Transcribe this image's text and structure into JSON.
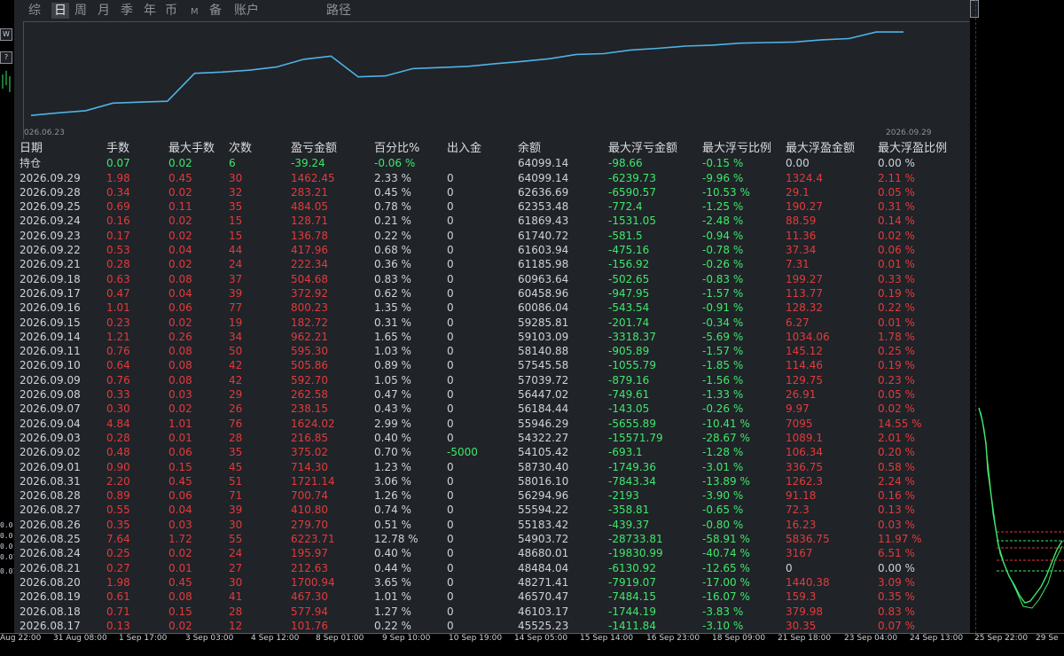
{
  "tabs": [
    "综",
    "日",
    "周",
    "月",
    "季",
    "年",
    "币",
    "M",
    "备",
    "账户",
    "路径"
  ],
  "active_tab": "日",
  "chart": {
    "start_date": "026.06.23",
    "end_date": "2026.09.29",
    "line_color": "#4fb3e6"
  },
  "headers": [
    "日期",
    "手数",
    "最大手数",
    "次数",
    "盈亏金额",
    "百分比%",
    "出入金",
    "余额",
    "最大浮亏金额",
    "最大浮亏比例",
    "最大浮盈金额",
    "最大浮盈比例"
  ],
  "holding": [
    "持仓",
    "0.07",
    "0.02",
    "6",
    "-39.24",
    "-0.06 %",
    "",
    "64099.14",
    "-98.66",
    "-0.15 %",
    "0.00",
    "0.00 %"
  ],
  "rows": [
    [
      "2026.09.29",
      "1.98",
      "0.45",
      "30",
      "1462.45",
      "2.33 %",
      "0",
      "64099.14",
      "-6239.73",
      "-9.96 %",
      "1324.4",
      "2.11 %"
    ],
    [
      "2026.09.28",
      "0.34",
      "0.02",
      "32",
      "283.21",
      "0.45 %",
      "0",
      "62636.69",
      "-6590.57",
      "-10.53 %",
      "29.1",
      "0.05 %"
    ],
    [
      "2026.09.25",
      "0.69",
      "0.11",
      "35",
      "484.05",
      "0.78 %",
      "0",
      "62353.48",
      "-772.4",
      "-1.25 %",
      "190.27",
      "0.31 %"
    ],
    [
      "2026.09.24",
      "0.16",
      "0.02",
      "15",
      "128.71",
      "0.21 %",
      "0",
      "61869.43",
      "-1531.05",
      "-2.48 %",
      "88.59",
      "0.14 %"
    ],
    [
      "2026.09.23",
      "0.17",
      "0.02",
      "15",
      "136.78",
      "0.22 %",
      "0",
      "61740.72",
      "-581.5",
      "-0.94 %",
      "11.36",
      "0.02 %"
    ],
    [
      "2026.09.22",
      "0.53",
      "0.04",
      "44",
      "417.96",
      "0.68 %",
      "0",
      "61603.94",
      "-475.16",
      "-0.78 %",
      "37.34",
      "0.06 %"
    ],
    [
      "2026.09.21",
      "0.28",
      "0.02",
      "24",
      "222.34",
      "0.36 %",
      "0",
      "61185.98",
      "-156.92",
      "-0.26 %",
      "7.31",
      "0.01 %"
    ],
    [
      "2026.09.18",
      "0.63",
      "0.08",
      "37",
      "504.68",
      "0.83 %",
      "0",
      "60963.64",
      "-502.65",
      "-0.83 %",
      "199.27",
      "0.33 %"
    ],
    [
      "2026.09.17",
      "0.47",
      "0.04",
      "39",
      "372.92",
      "0.62 %",
      "0",
      "60458.96",
      "-947.95",
      "-1.57 %",
      "113.77",
      "0.19 %"
    ],
    [
      "2026.09.16",
      "1.01",
      "0.06",
      "77",
      "800.23",
      "1.35 %",
      "0",
      "60086.04",
      "-543.54",
      "-0.91 %",
      "128.32",
      "0.22 %"
    ],
    [
      "2026.09.15",
      "0.23",
      "0.02",
      "19",
      "182.72",
      "0.31 %",
      "0",
      "59285.81",
      "-201.74",
      "-0.34 %",
      "6.27",
      "0.01 %"
    ],
    [
      "2026.09.14",
      "1.21",
      "0.26",
      "34",
      "962.21",
      "1.65 %",
      "0",
      "59103.09",
      "-3318.37",
      "-5.69 %",
      "1034.06",
      "1.78 %"
    ],
    [
      "2026.09.11",
      "0.76",
      "0.08",
      "50",
      "595.30",
      "1.03 %",
      "0",
      "58140.88",
      "-905.89",
      "-1.57 %",
      "145.12",
      "0.25 %"
    ],
    [
      "2026.09.10",
      "0.64",
      "0.08",
      "42",
      "505.86",
      "0.89 %",
      "0",
      "57545.58",
      "-1055.79",
      "-1.85 %",
      "114.46",
      "0.19 %"
    ],
    [
      "2026.09.09",
      "0.76",
      "0.08",
      "42",
      "592.70",
      "1.05 %",
      "0",
      "57039.72",
      "-879.16",
      "-1.56 %",
      "129.75",
      "0.23 %"
    ],
    [
      "2026.09.08",
      "0.33",
      "0.03",
      "29",
      "262.58",
      "0.47 %",
      "0",
      "56447.02",
      "-749.61",
      "-1.33 %",
      "26.91",
      "0.05 %"
    ],
    [
      "2026.09.07",
      "0.30",
      "0.02",
      "26",
      "238.15",
      "0.43 %",
      "0",
      "56184.44",
      "-143.05",
      "-0.26 %",
      "9.97",
      "0.02 %"
    ],
    [
      "2026.09.04",
      "4.84",
      "1.01",
      "76",
      "1624.02",
      "2.99 %",
      "0",
      "55946.29",
      "-5655.89",
      "-10.41 %",
      "7095",
      "14.55 %"
    ],
    [
      "2026.09.03",
      "0.28",
      "0.01",
      "28",
      "216.85",
      "0.40 %",
      "0",
      "54322.27",
      "-15571.79",
      "-28.67 %",
      "1089.1",
      "2.01 %"
    ],
    [
      "2026.09.02",
      "0.48",
      "0.06",
      "35",
      "375.02",
      "0.70 %",
      "-5000",
      "54105.42",
      "-693.1",
      "-1.28 %",
      "106.34",
      "0.20 %"
    ],
    [
      "2026.09.01",
      "0.90",
      "0.15",
      "45",
      "714.30",
      "1.23 %",
      "0",
      "58730.40",
      "-1749.36",
      "-3.01 %",
      "336.75",
      "0.58 %"
    ],
    [
      "2026.08.31",
      "2.20",
      "0.45",
      "51",
      "1721.14",
      "3.06 %",
      "0",
      "58016.10",
      "-7843.34",
      "-13.89 %",
      "1262.3",
      "2.24 %"
    ],
    [
      "2026.08.28",
      "0.89",
      "0.06",
      "71",
      "700.74",
      "1.26 %",
      "0",
      "56294.96",
      "-2193",
      "-3.90 %",
      "91.18",
      "0.16 %"
    ],
    [
      "2026.08.27",
      "0.55",
      "0.04",
      "39",
      "410.80",
      "0.74 %",
      "0",
      "55594.22",
      "-358.81",
      "-0.65 %",
      "72.3",
      "0.13 %"
    ],
    [
      "2026.08.26",
      "0.35",
      "0.03",
      "30",
      "279.70",
      "0.51 %",
      "0",
      "55183.42",
      "-439.37",
      "-0.80 %",
      "16.23",
      "0.03 %"
    ],
    [
      "2026.08.25",
      "7.64",
      "1.72",
      "55",
      "6223.71",
      "12.78 %",
      "0",
      "54903.72",
      "-28733.81",
      "-58.91 %",
      "5836.75",
      "11.97 %"
    ],
    [
      "2026.08.24",
      "0.25",
      "0.02",
      "24",
      "195.97",
      "0.40 %",
      "0",
      "48680.01",
      "-19830.99",
      "-40.74 %",
      "3167",
      "6.51 %"
    ],
    [
      "2026.08.21",
      "0.27",
      "0.01",
      "27",
      "212.63",
      "0.44 %",
      "0",
      "48484.04",
      "-6130.92",
      "-12.65 %",
      "0",
      "0.00 %"
    ],
    [
      "2026.08.20",
      "1.98",
      "0.45",
      "30",
      "1700.94",
      "3.65 %",
      "0",
      "48271.41",
      "-7919.07",
      "-17.00 %",
      "1440.38",
      "3.09 %"
    ],
    [
      "2026.08.19",
      "0.61",
      "0.08",
      "41",
      "467.30",
      "1.01 %",
      "0",
      "46570.47",
      "-7484.15",
      "-16.07 %",
      "159.3",
      "0.35 %"
    ],
    [
      "2026.08.18",
      "0.71",
      "0.15",
      "28",
      "577.94",
      "1.27 %",
      "0",
      "46103.17",
      "-1744.19",
      "-3.83 %",
      "379.98",
      "0.83 %"
    ],
    [
      "2026.08.17",
      "0.13",
      "0.02",
      "12",
      "101.76",
      "0.22 %",
      "0",
      "45525.23",
      "-1411.84",
      "-3.10 %",
      "30.35",
      "0.07 %"
    ]
  ],
  "left_labels": [
    "W",
    "?",
    "0.0",
    "0.0",
    "0.0",
    "0.01",
    "0.01"
  ],
  "time_axis": [
    "Aug 22:00",
    "31 Aug 08:00",
    "1 Sep 17:00",
    "3 Sep 03:00",
    "4 Sep 12:00",
    "8 Sep 01:00",
    "9 Sep 10:00",
    "10 Sep 19:00",
    "14 Sep 05:00",
    "15 Sep 14:00",
    "16 Sep 23:00",
    "18 Sep 09:00",
    "21 Sep 18:00",
    "23 Sep 04:00",
    "24 Sep 13:00",
    "25 Sep 22:00",
    "29 Se"
  ]
}
